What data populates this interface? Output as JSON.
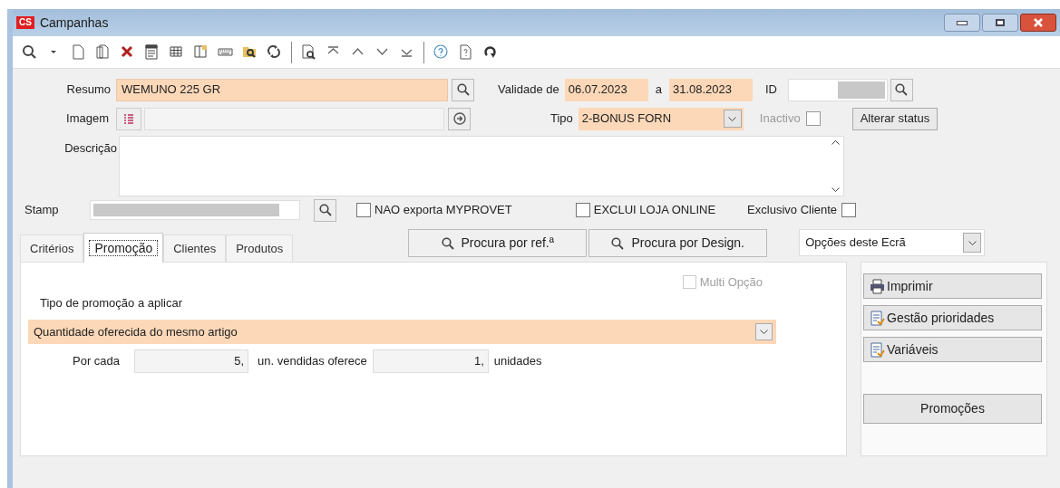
{
  "window": {
    "title": "Campanhas",
    "logo": "CS"
  },
  "form": {
    "resumo": {
      "label": "Resumo",
      "value": "WEMUNO 225 GR"
    },
    "validade": {
      "label": "Validade de",
      "from": "06.07.2023",
      "separator": "a",
      "to": "31.08.2023"
    },
    "id": {
      "label": "ID"
    },
    "imagem": {
      "label": "Imagem"
    },
    "tipo": {
      "label": "Tipo",
      "value": "2-BONUS FORN"
    },
    "inactivo": {
      "label": "Inactivo",
      "checked": false,
      "disabled": true
    },
    "alterar_status": "Alterar status",
    "descricao": {
      "label": "Descrição"
    },
    "stamp": {
      "label": "Stamp"
    },
    "flags": [
      {
        "label": "NAO exporta MYPROVET",
        "checked": false,
        "kind": "box_left"
      },
      {
        "label": "EXCLUI LOJA ONLINE",
        "checked": false,
        "kind": "box_left"
      },
      {
        "label": "Exclusivo Cliente",
        "checked": false,
        "kind": "box_right"
      }
    ]
  },
  "tabs": [
    {
      "label": "Critérios",
      "selected": false
    },
    {
      "label": "Promoção",
      "selected": true
    },
    {
      "label": "Clientes",
      "selected": false
    },
    {
      "label": "Produtos",
      "selected": false
    }
  ],
  "search_buttons": [
    "Procura por ref.ª",
    "Procura por Design."
  ],
  "options_dropdown": {
    "value": "Opções deste Ecrã"
  },
  "promotion": {
    "multi_option": {
      "label": "Multi Opção",
      "checked": false,
      "disabled": true
    },
    "type_label": "Tipo de promoção a aplicar",
    "type_value": "Quantidade oferecida do mesmo artigo",
    "per_label": "Por cada",
    "per_value": "5,",
    "offer_label": "un. vendidas oferece",
    "offer_value": "1,",
    "units_label": "unidades"
  },
  "side_buttons": [
    {
      "label": "Imprimir",
      "kind": "printer"
    },
    {
      "label": "Gestão prioridades",
      "kind": "document"
    },
    {
      "label": "Variáveis",
      "kind": "document"
    },
    {
      "label": "Promoções",
      "kind": "plain"
    }
  ]
}
